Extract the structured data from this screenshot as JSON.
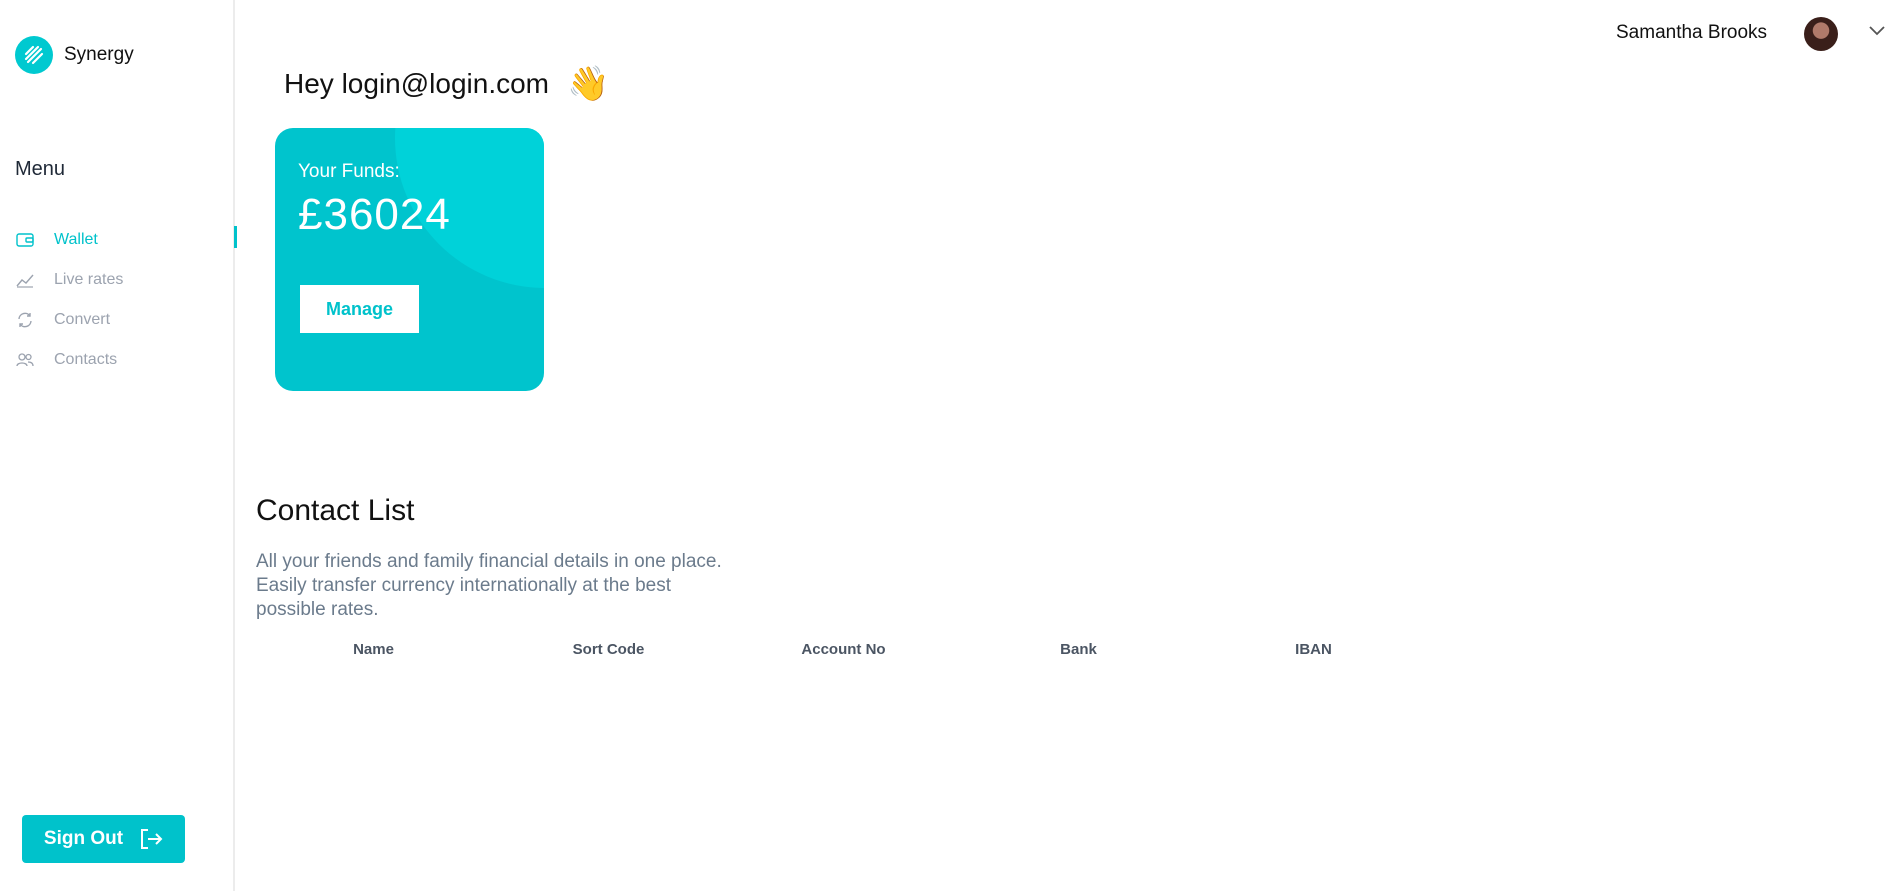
{
  "brand": {
    "name": "Synergy",
    "accent": "#00c2cb"
  },
  "sidebar": {
    "menu_title": "Menu",
    "items": [
      {
        "label": "Wallet",
        "icon": "wallet-icon",
        "active": true
      },
      {
        "label": "Live rates",
        "icon": "chart-line-icon",
        "active": false
      },
      {
        "label": "Convert",
        "icon": "refresh-icon",
        "active": false
      },
      {
        "label": "Contacts",
        "icon": "users-icon",
        "active": false
      }
    ],
    "signout_label": "Sign Out"
  },
  "header": {
    "user_name": "Samantha Brooks"
  },
  "greeting": {
    "text": "Hey login@login.com",
    "emoji": "👋"
  },
  "funds": {
    "label": "Your Funds:",
    "amount": "£36024",
    "button_label": "Manage"
  },
  "contacts": {
    "title": "Contact List",
    "description": "All your friends and family financial details in one place. Easily transfer currency internationally at the best possible rates.",
    "columns": [
      "Name",
      "Sort Code",
      "Account No",
      "Bank",
      "IBAN"
    ]
  }
}
